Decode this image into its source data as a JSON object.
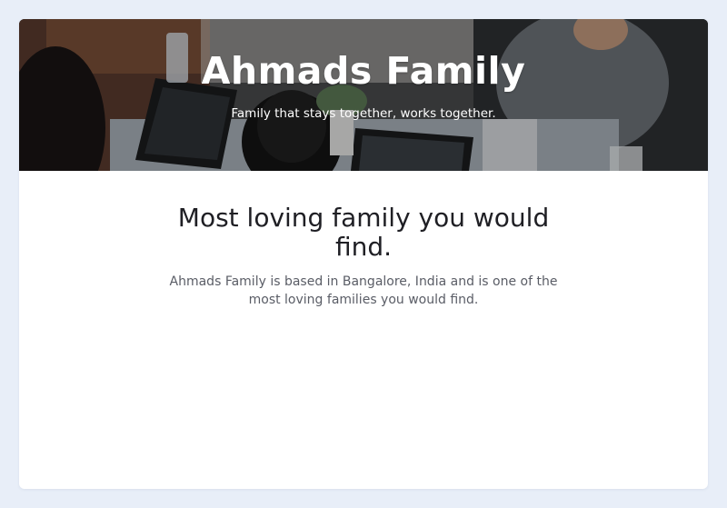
{
  "hero": {
    "title": "Ahmads Family",
    "subtitle": "Family that stays together, works together."
  },
  "main": {
    "heading": "Most loving family you would find.",
    "description": "Ahmads  Family is based in Bangalore, India and is one of the most loving families you would find."
  },
  "colors": {
    "page_background": "#e8eef8",
    "card_background": "#ffffff",
    "heading_text": "#1f1f24",
    "body_text": "#5a5d66",
    "hero_text": "#ffffff"
  }
}
